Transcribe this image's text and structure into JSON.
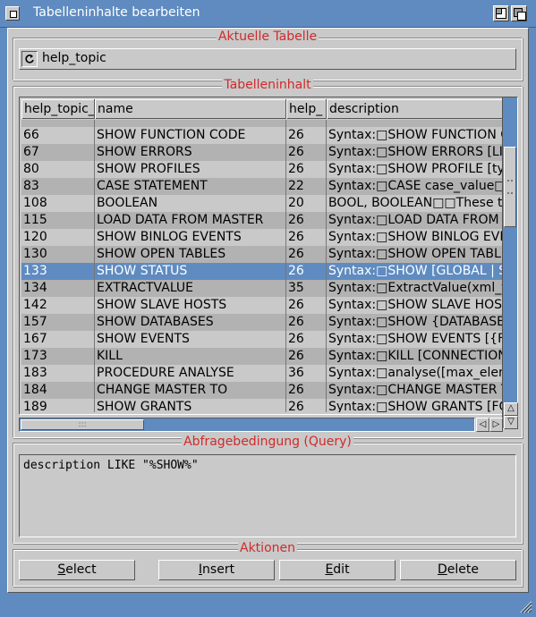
{
  "window": {
    "title": "Tabelleninhalte bearbeiten"
  },
  "current_table": {
    "group_title": "Aktuelle Tabelle",
    "value": "help_topic"
  },
  "table_content": {
    "group_title": "Tabelleninhalt",
    "columns": [
      "help_topic_",
      "name",
      "help_",
      "description"
    ],
    "partial_top_row": [
      "",
      "",
      "",
      ""
    ],
    "rows": [
      [
        "66",
        "SHOW FUNCTION CODE",
        "26",
        "Syntax:□SHOW FUNCTION C"
      ],
      [
        "67",
        "SHOW ERRORS",
        "26",
        "Syntax:□SHOW ERRORS [LI"
      ],
      [
        "80",
        "SHOW PROFILES",
        "26",
        "Syntax:□SHOW PROFILE [typ"
      ],
      [
        "83",
        "CASE STATEMENT",
        "22",
        "Syntax:□CASE case_value□"
      ],
      [
        "108",
        "BOOLEAN",
        "20",
        "BOOL, BOOLEAN□□These t"
      ],
      [
        "115",
        "LOAD DATA FROM MASTER",
        "26",
        "Syntax:□LOAD DATA FROM"
      ],
      [
        "120",
        "SHOW BINLOG EVENTS",
        "26",
        "Syntax:□SHOW BINLOG EVE"
      ],
      [
        "130",
        "SHOW OPEN TABLES",
        "26",
        "Syntax:□SHOW OPEN TABLI"
      ],
      [
        "133",
        "SHOW STATUS",
        "26",
        "Syntax:□SHOW [GLOBAL | S"
      ],
      [
        "134",
        "EXTRACTVALUE",
        "35",
        "Syntax:□ExtractValue(xml_fr"
      ],
      [
        "142",
        "SHOW SLAVE HOSTS",
        "26",
        "Syntax:□SHOW SLAVE HOST"
      ],
      [
        "157",
        "SHOW DATABASES",
        "26",
        "Syntax:□SHOW {DATABASE"
      ],
      [
        "167",
        "SHOW EVENTS",
        "26",
        "Syntax:□SHOW EVENTS [{F"
      ],
      [
        "173",
        "KILL",
        "26",
        "Syntax:□KILL [CONNECTION"
      ],
      [
        "183",
        "PROCEDURE ANALYSE",
        "36",
        "Syntax:□analyse([max_elem"
      ],
      [
        "184",
        "CHANGE MASTER TO",
        "26",
        "Syntax:□CHANGE MASTER T"
      ],
      [
        "189",
        "SHOW GRANTS",
        "26",
        "Syntax:□SHOW GRANTS [FC"
      ]
    ],
    "selected_row_id": "133"
  },
  "query": {
    "group_title": "Abfragebedingung (Query)",
    "value": "description LIKE \"%SHOW%\""
  },
  "actions": {
    "group_title": "Aktionen",
    "select_label": "Select",
    "insert_label": "Insert",
    "edit_label": "Edit",
    "delete_label": "Delete"
  },
  "colors": {
    "accent": "#5f8bc0",
    "panel": "#c9c9c9",
    "group_title": "#d12a2a"
  }
}
